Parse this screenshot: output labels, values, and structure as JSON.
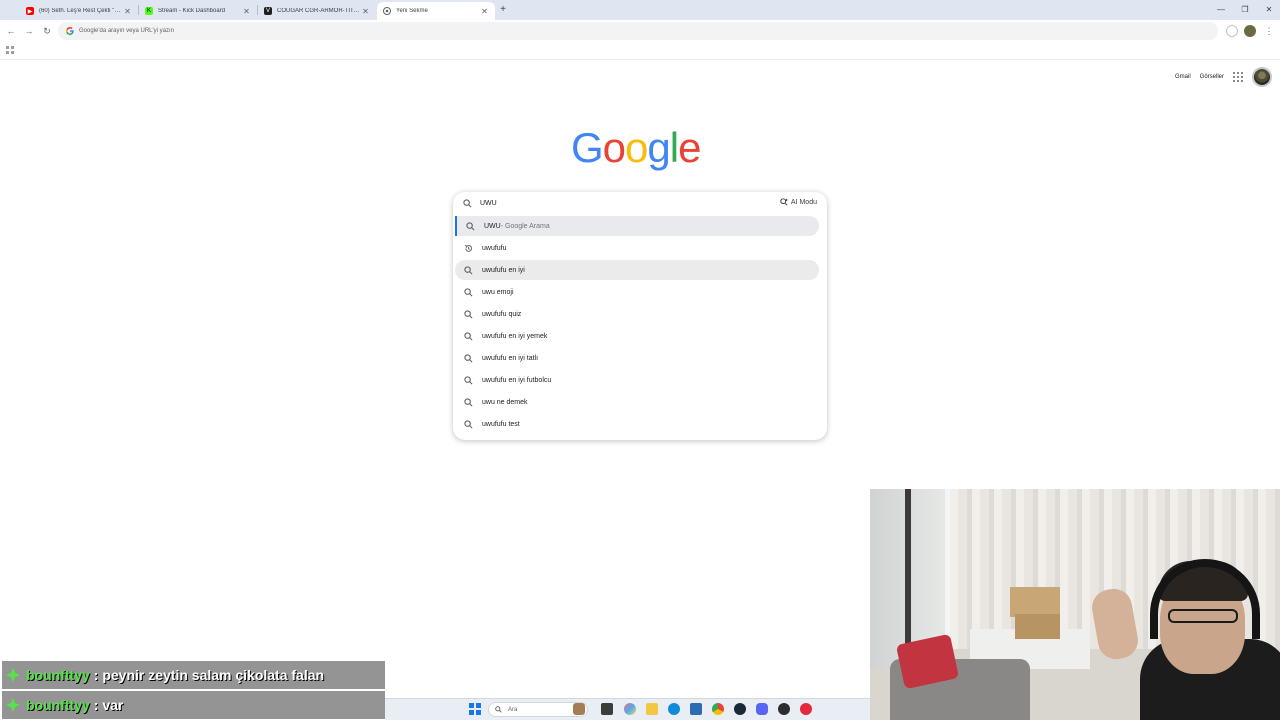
{
  "tabs": [
    {
      "title": "(60) Seth. Leş'e Rest Çekti \"Smm",
      "icon": "youtube-icon",
      "color": "#ff0000"
    },
    {
      "title": "Stream - Kick Dashboard",
      "icon": "kick-icon",
      "color": "#53fc18"
    },
    {
      "title": "COUGAR CGR-ARMOR-TITAN",
      "icon": "cougar-icon",
      "color": "#1f1f1f"
    },
    {
      "title": "Yeni Sekme",
      "icon": "chrome-icon",
      "color": "#5f6368",
      "active": true
    }
  ],
  "omnibox": {
    "placeholder": "Google'da arayın veya URL'yi yazın"
  },
  "google_links": {
    "gmail": "Gmail",
    "images": "Görseller"
  },
  "logo": {
    "letters": [
      "G",
      "o",
      "o",
      "g",
      "l",
      "e"
    ]
  },
  "search": {
    "query": "UWU",
    "ai_mode": "AI Modu",
    "suggestions": [
      {
        "text": "UWU",
        "sub": " - Google Arama",
        "icon": "search-icon",
        "state": "selected"
      },
      {
        "text": "uwufufu",
        "sub": "",
        "icon": "history-icon",
        "state": ""
      },
      {
        "text": "uwufufu en iyi",
        "sub": "",
        "icon": "search-icon",
        "state": "hover"
      },
      {
        "text": "uwu emoji",
        "sub": "",
        "icon": "search-icon",
        "state": ""
      },
      {
        "text": "uwufufu quiz",
        "sub": "",
        "icon": "search-icon",
        "state": ""
      },
      {
        "text": "uwufufu en iyi yemek",
        "sub": "",
        "icon": "search-icon",
        "state": ""
      },
      {
        "text": "uwufufu en iyi tatlı",
        "sub": "",
        "icon": "search-icon",
        "state": ""
      },
      {
        "text": "uwufufu en iyi futbolcu",
        "sub": "",
        "icon": "search-icon",
        "state": ""
      },
      {
        "text": "uwu ne demek",
        "sub": "",
        "icon": "search-icon",
        "state": ""
      },
      {
        "text": "uwufufu test",
        "sub": "",
        "icon": "search-icon",
        "state": ""
      }
    ]
  },
  "chat": [
    {
      "user": "bounfttyy",
      "message": ": peynir zeytin salam çikolata falan"
    },
    {
      "user": "bounfttyy",
      "message": ": var"
    }
  ],
  "taskbar": {
    "search_placeholder": "Ara"
  },
  "colors": {
    "accent": "#1a73e8",
    "chat_user": "#57e34b"
  }
}
